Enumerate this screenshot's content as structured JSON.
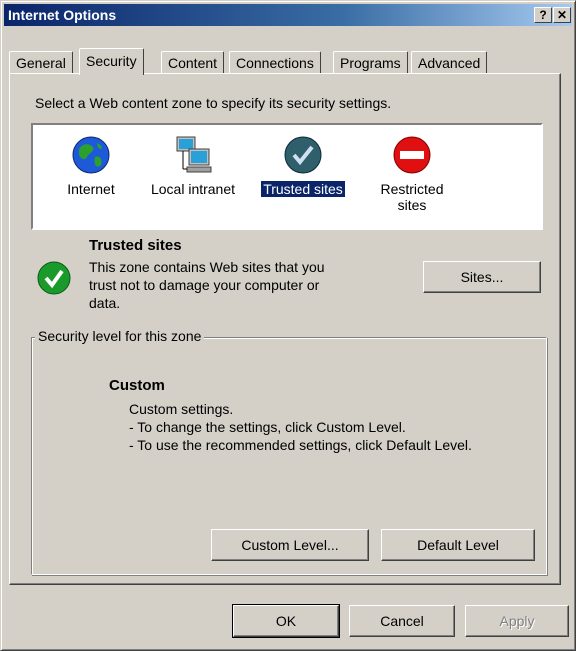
{
  "window": {
    "title": "Internet Options",
    "help_glyph": "?",
    "close_glyph": "✕"
  },
  "tabs": [
    {
      "label": "General"
    },
    {
      "label": "Security"
    },
    {
      "label": "Content"
    },
    {
      "label": "Connections"
    },
    {
      "label": "Programs"
    },
    {
      "label": "Advanced"
    }
  ],
  "active_tab": "Security",
  "security": {
    "instruction": "Select a Web content zone to specify its security settings.",
    "zones": [
      {
        "label": "Internet",
        "icon": "globe-icon"
      },
      {
        "label": "Local intranet",
        "icon": "network-computers-icon"
      },
      {
        "label": "Trusted sites",
        "icon": "checkmark-icon",
        "selected": true
      },
      {
        "label_line1": "Restricted",
        "label_line2": "sites",
        "icon": "no-entry-icon"
      }
    ],
    "selected_zone": {
      "title": "Trusted sites",
      "description_lines": [
        "This zone contains Web sites that you",
        "trust not to damage your computer or",
        "data."
      ],
      "sites_button": "Sites..."
    },
    "level_group": {
      "label": "Security level for this zone",
      "level_name": "Custom",
      "lines": [
        "Custom settings.",
        "- To change the settings, click Custom Level.",
        "- To use the recommended settings, click Default Level."
      ],
      "custom_level_button": "Custom Level...",
      "default_level_button": "Default Level"
    }
  },
  "footer": {
    "ok": "OK",
    "cancel": "Cancel",
    "apply": "Apply"
  },
  "colors": {
    "face": "#d4d0c8",
    "title_bar": "#0a246a",
    "selection": "#0a246a",
    "checkmark_green": "#1a9a2a",
    "restricted_red": "#e01010"
  }
}
